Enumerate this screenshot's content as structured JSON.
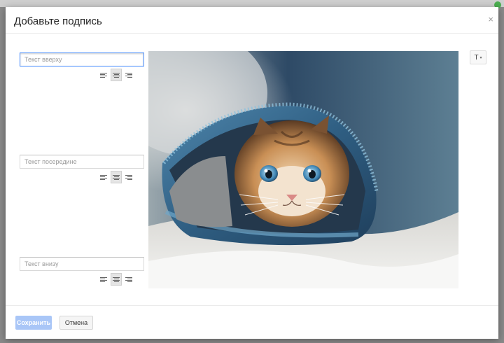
{
  "dialog": {
    "title": "Добавьте подпись",
    "close_glyph": "×"
  },
  "caption_fields": [
    {
      "placeholder": "Текст вверху",
      "value": "",
      "focused": true,
      "alignment": "center"
    },
    {
      "placeholder": "Текст посередине",
      "value": "",
      "focused": false,
      "alignment": "center"
    },
    {
      "placeholder": "Текст внизу",
      "value": "",
      "focused": false,
      "alignment": "center"
    }
  ],
  "font_button": {
    "label": "T",
    "caret": "▾"
  },
  "preview_image": {
    "subject": "kitten-in-denim"
  },
  "footer": {
    "save_label": "Сохранить",
    "cancel_label": "Отмена"
  },
  "colors": {
    "focus": "#4d90fe",
    "save_disabled": "#a9c6f7",
    "close": "#999999"
  }
}
